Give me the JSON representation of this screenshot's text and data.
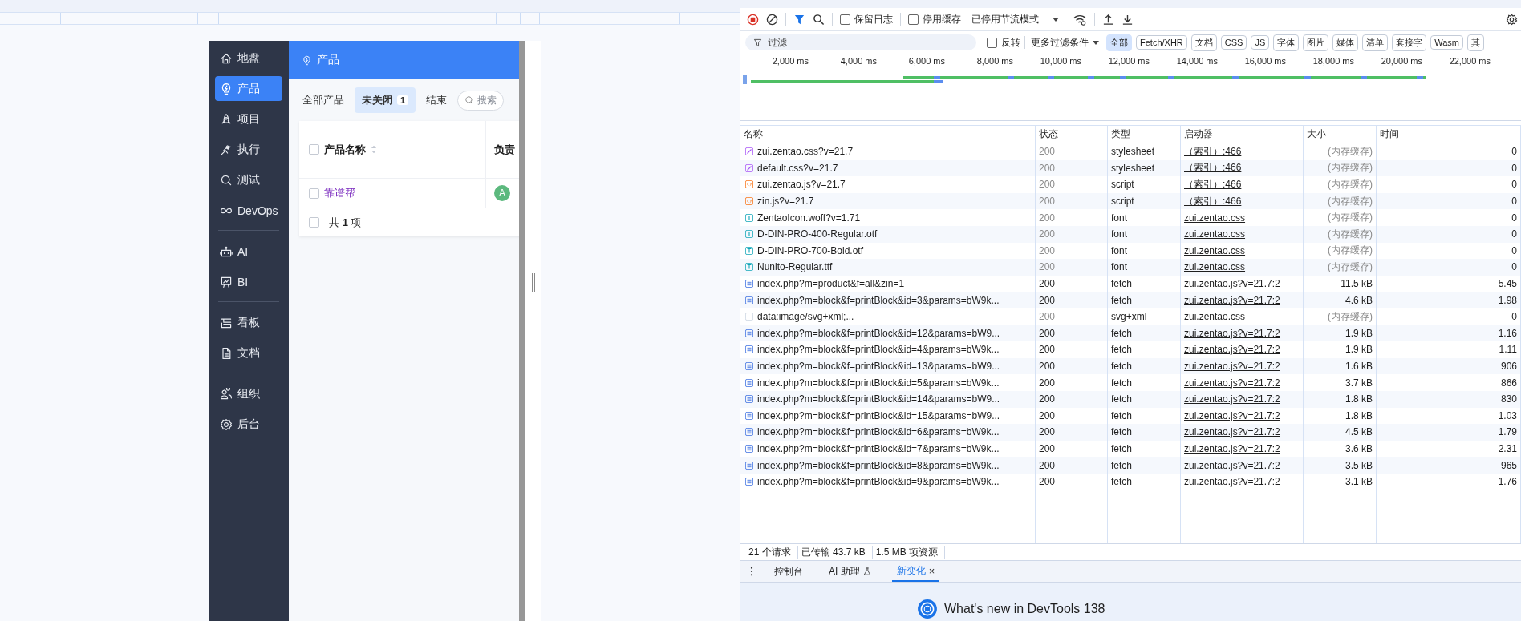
{
  "app": {
    "sidebar": {
      "groups": [
        {
          "items": [
            {
              "label": "地盘",
              "selected": false
            },
            {
              "label": "产品",
              "selected": true
            },
            {
              "label": "项目",
              "selected": false
            },
            {
              "label": "执行",
              "selected": false
            },
            {
              "label": "测试",
              "selected": false
            },
            {
              "label": "DevOps",
              "selected": false
            }
          ]
        },
        {
          "items": [
            {
              "label": "AI",
              "selected": false
            },
            {
              "label": "BI",
              "selected": false
            }
          ]
        },
        {
          "items": [
            {
              "label": "看板",
              "selected": false
            },
            {
              "label": "文档",
              "selected": false
            }
          ]
        },
        {
          "items": [
            {
              "label": "组织",
              "selected": false
            },
            {
              "label": "后台",
              "selected": false
            }
          ]
        }
      ]
    },
    "header": {
      "title": "产品"
    },
    "tabs": [
      {
        "label": "全部产品",
        "selected": false
      },
      {
        "label": "未关闭",
        "count": "1",
        "selected": true
      },
      {
        "label": "结束",
        "selected": false
      }
    ],
    "search": {
      "placeholder": "搜索"
    },
    "table": {
      "select_all_checked": false,
      "columns": [
        "产品名称",
        "负责"
      ],
      "rows": [
        {
          "name": "靠谱帮",
          "avatar": "A",
          "checked": false
        }
      ],
      "footer": {
        "text": "共 **1** 项",
        "checked": false
      }
    }
  },
  "devtools": {
    "toolbar": {
      "preserve_log": {
        "label": "保留日志",
        "checked": false
      },
      "disable_cache": {
        "label": "停用缓存",
        "checked": false
      },
      "throttling": "已停用节流模式"
    },
    "filter": {
      "placeholder": "过滤",
      "invert": {
        "label": "反转",
        "checked": false
      },
      "more_filters": "更多过滤条件",
      "types": [
        {
          "label": "全部",
          "selected": true
        },
        {
          "label": "Fetch/XHR",
          "selected": false
        },
        {
          "label": "文档",
          "selected": false
        },
        {
          "label": "CSS",
          "selected": false
        },
        {
          "label": "JS",
          "selected": false
        },
        {
          "label": "字体",
          "selected": false
        },
        {
          "label": "图片",
          "selected": false
        },
        {
          "label": "媒体",
          "selected": false
        },
        {
          "label": "清单",
          "selected": false
        },
        {
          "label": "套接字",
          "selected": false
        },
        {
          "label": "Wasm",
          "selected": false
        },
        {
          "label": "其",
          "selected": false
        }
      ]
    },
    "timeline": {
      "ticks": [
        "2,000 ms",
        "4,000 ms",
        "6,000 ms",
        "8,000 ms",
        "10,000 ms",
        "12,000 ms",
        "14,000 ms",
        "16,000 ms",
        "18,000 ms",
        "20,000 ms",
        "22,000 ms"
      ]
    },
    "network_table": {
      "columns": [
        "名称",
        "状态",
        "类型",
        "启动器",
        "大小",
        "时间"
      ],
      "rows": [
        {
          "kind": "css",
          "name": "zui.zentao.css?v=21.7",
          "status": "200",
          "cached": true,
          "type": "stylesheet",
          "initiator": "（索引）:466",
          "size": "(内存缓存)",
          "time": "0"
        },
        {
          "kind": "css",
          "name": "default.css?v=21.7",
          "status": "200",
          "cached": true,
          "type": "stylesheet",
          "initiator": "（索引）:466",
          "size": "(内存缓存)",
          "time": "0"
        },
        {
          "kind": "js",
          "name": "zui.zentao.js?v=21.7",
          "status": "200",
          "cached": true,
          "type": "script",
          "initiator": "（索引）:466",
          "size": "(内存缓存)",
          "time": "0"
        },
        {
          "kind": "js",
          "name": "zin.js?v=21.7",
          "status": "200",
          "cached": true,
          "type": "script",
          "initiator": "（索引）:466",
          "size": "(内存缓存)",
          "time": "0"
        },
        {
          "kind": "font",
          "name": "ZentaoIcon.woff?v=1.71",
          "status": "200",
          "cached": true,
          "type": "font",
          "initiator": "zui.zentao.css",
          "size": "(内存缓存)",
          "time": "0"
        },
        {
          "kind": "font",
          "name": "D-DIN-PRO-400-Regular.otf",
          "status": "200",
          "cached": true,
          "type": "font",
          "initiator": "zui.zentao.css",
          "size": "(内存缓存)",
          "time": "0"
        },
        {
          "kind": "font",
          "name": "D-DIN-PRO-700-Bold.otf",
          "status": "200",
          "cached": true,
          "type": "font",
          "initiator": "zui.zentao.css",
          "size": "(内存缓存)",
          "time": "0"
        },
        {
          "kind": "font",
          "name": "Nunito-Regular.ttf",
          "status": "200",
          "cached": true,
          "type": "font",
          "initiator": "zui.zentao.css",
          "size": "(内存缓存)",
          "time": "0"
        },
        {
          "kind": "doc",
          "name": "index.php?m=product&f=all&zin=1",
          "status": "200",
          "cached": false,
          "type": "fetch",
          "initiator": "zui.zentao.js?v=21.7:2",
          "size": "11.5 kB",
          "time": "5.45"
        },
        {
          "kind": "doc",
          "name": "index.php?m=block&f=printBlock&id=3&params=bW9k...",
          "status": "200",
          "cached": false,
          "type": "fetch",
          "initiator": "zui.zentao.js?v=21.7:2",
          "size": "4.6 kB",
          "time": "1.98"
        },
        {
          "kind": "image",
          "name": "data:image/svg+xml;...",
          "status": "200",
          "cached": true,
          "type": "svg+xml",
          "initiator": "zui.zentao.css",
          "size": "(内存缓存)",
          "time": "0"
        },
        {
          "kind": "doc",
          "name": "index.php?m=block&f=printBlock&id=12&params=bW9...",
          "status": "200",
          "cached": false,
          "type": "fetch",
          "initiator": "zui.zentao.js?v=21.7:2",
          "size": "1.9 kB",
          "time": "1.16"
        },
        {
          "kind": "doc",
          "name": "index.php?m=block&f=printBlock&id=4&params=bW9k...",
          "status": "200",
          "cached": false,
          "type": "fetch",
          "initiator": "zui.zentao.js?v=21.7:2",
          "size": "1.9 kB",
          "time": "1.11"
        },
        {
          "kind": "doc",
          "name": "index.php?m=block&f=printBlock&id=13&params=bW9...",
          "status": "200",
          "cached": false,
          "type": "fetch",
          "initiator": "zui.zentao.js?v=21.7:2",
          "size": "1.6 kB",
          "time": "906"
        },
        {
          "kind": "doc",
          "name": "index.php?m=block&f=printBlock&id=5&params=bW9k...",
          "status": "200",
          "cached": false,
          "type": "fetch",
          "initiator": "zui.zentao.js?v=21.7:2",
          "size": "3.7 kB",
          "time": "866"
        },
        {
          "kind": "doc",
          "name": "index.php?m=block&f=printBlock&id=14&params=bW9...",
          "status": "200",
          "cached": false,
          "type": "fetch",
          "initiator": "zui.zentao.js?v=21.7:2",
          "size": "1.8 kB",
          "time": "830"
        },
        {
          "kind": "doc",
          "name": "index.php?m=block&f=printBlock&id=15&params=bW9...",
          "status": "200",
          "cached": false,
          "type": "fetch",
          "initiator": "zui.zentao.js?v=21.7:2",
          "size": "1.8 kB",
          "time": "1.03"
        },
        {
          "kind": "doc",
          "name": "index.php?m=block&f=printBlock&id=6&params=bW9k...",
          "status": "200",
          "cached": false,
          "type": "fetch",
          "initiator": "zui.zentao.js?v=21.7:2",
          "size": "4.5 kB",
          "time": "1.79"
        },
        {
          "kind": "doc",
          "name": "index.php?m=block&f=printBlock&id=7&params=bW9k...",
          "status": "200",
          "cached": false,
          "type": "fetch",
          "initiator": "zui.zentao.js?v=21.7:2",
          "size": "3.6 kB",
          "time": "2.31"
        },
        {
          "kind": "doc",
          "name": "index.php?m=block&f=printBlock&id=8&params=bW9k...",
          "status": "200",
          "cached": false,
          "type": "fetch",
          "initiator": "zui.zentao.js?v=21.7:2",
          "size": "3.5 kB",
          "time": "965"
        },
        {
          "kind": "doc",
          "name": "index.php?m=block&f=printBlock&id=9&params=bW9k...",
          "status": "200",
          "cached": false,
          "type": "fetch",
          "initiator": "zui.zentao.js?v=21.7:2",
          "size": "3.1 kB",
          "time": "1.76"
        }
      ]
    },
    "summary": [
      "21 个请求",
      "已传输 43.7 kB",
      "1.5 MB 项资源"
    ],
    "drawer_tabs": [
      {
        "label": "控制台",
        "selected": false
      },
      {
        "label": "AI 助理",
        "selected": false,
        "experimental": true
      },
      {
        "label": "新变化",
        "selected": true,
        "close": "×"
      }
    ],
    "whats_new": "What's new in DevTools 138"
  }
}
